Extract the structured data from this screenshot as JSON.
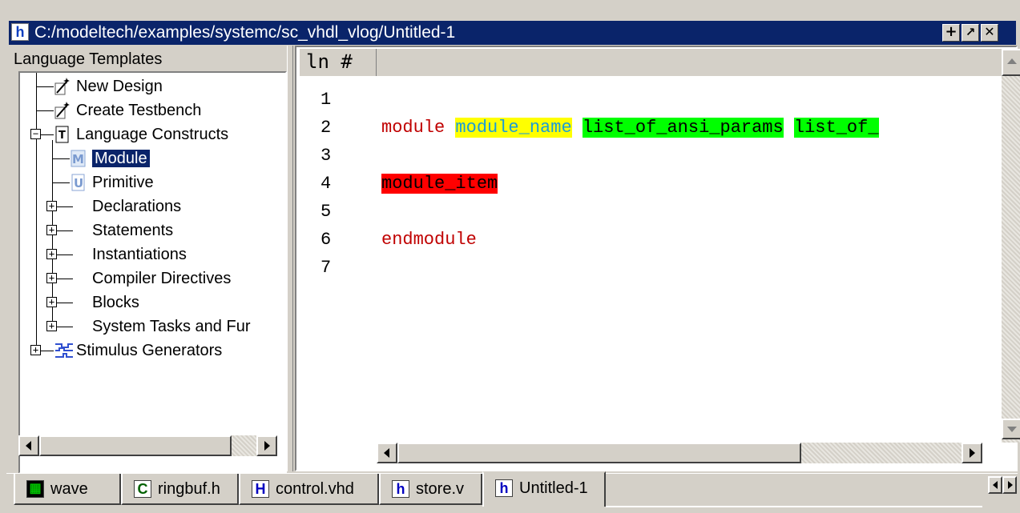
{
  "window": {
    "title": "C:/modeltech/examples/systemc/sc_vhdl_vlog/Untitled-1",
    "buttons": [
      "+",
      "↗",
      "✕"
    ]
  },
  "left_pane": {
    "header": "Language Templates",
    "tree": [
      {
        "label": "New Design",
        "icon": "wand-icon",
        "level": 1,
        "expander": null
      },
      {
        "label": "Create Testbench",
        "icon": "wand-icon",
        "level": 1,
        "expander": null
      },
      {
        "label": "Language Constructs",
        "icon": "template-icon",
        "level": 1,
        "expander": "-"
      },
      {
        "label": "Module",
        "icon": "module-icon",
        "level": 2,
        "expander": null,
        "selected": true
      },
      {
        "label": "Primitive",
        "icon": "primitive-icon",
        "level": 2,
        "expander": null
      },
      {
        "label": "Declarations",
        "icon": null,
        "level": 2,
        "expander": "+"
      },
      {
        "label": "Statements",
        "icon": null,
        "level": 2,
        "expander": "+"
      },
      {
        "label": "Instantiations",
        "icon": null,
        "level": 2,
        "expander": "+"
      },
      {
        "label": "Compiler Directives",
        "icon": null,
        "level": 2,
        "expander": "+"
      },
      {
        "label": "Blocks",
        "icon": null,
        "level": 2,
        "expander": "+"
      },
      {
        "label": "System Tasks and Fur",
        "icon": null,
        "level": 2,
        "expander": "+"
      },
      {
        "label": "Stimulus Generators",
        "icon": "stimulus-icon",
        "level": 1,
        "expander": "+"
      }
    ]
  },
  "editor": {
    "header": "ln #",
    "lines": [
      {
        "no": "1",
        "segments": []
      },
      {
        "no": "2",
        "segments": [
          {
            "text": "module",
            "style": "kw"
          },
          {
            "text": " ",
            "style": ""
          },
          {
            "text": "module_name",
            "style": "name"
          },
          {
            "text": " ",
            "style": ""
          },
          {
            "text": "list_of_ansi_params",
            "style": "green"
          },
          {
            "text": " ",
            "style": ""
          },
          {
            "text": "list_of_",
            "style": "green"
          }
        ]
      },
      {
        "no": "3",
        "segments": []
      },
      {
        "no": "4",
        "segments": [
          {
            "text": "module_item",
            "style": "red"
          }
        ]
      },
      {
        "no": "5",
        "segments": []
      },
      {
        "no": "6",
        "segments": [
          {
            "text": "endmodule",
            "style": "kw"
          }
        ]
      },
      {
        "no": "7",
        "segments": []
      }
    ]
  },
  "tabs": [
    {
      "label": "wave",
      "icon": "wave-icon",
      "icon_char": "▦"
    },
    {
      "label": "ringbuf.h",
      "icon": "c-file-icon",
      "icon_char": "C"
    },
    {
      "label": "control.vhd",
      "icon": "vhdl-file-icon",
      "icon_char": "H"
    },
    {
      "label": "store.v",
      "icon": "verilog-file-icon",
      "icon_char": "h"
    },
    {
      "label": "Untitled-1",
      "icon": "verilog-file-icon",
      "icon_char": "h",
      "active": true
    }
  ],
  "colors": {
    "titlebar": "#0a246a",
    "keyword": "#c00000",
    "name_bg": "#ffff00",
    "param_bg": "#00ff00",
    "item_bg": "#ff0000"
  }
}
